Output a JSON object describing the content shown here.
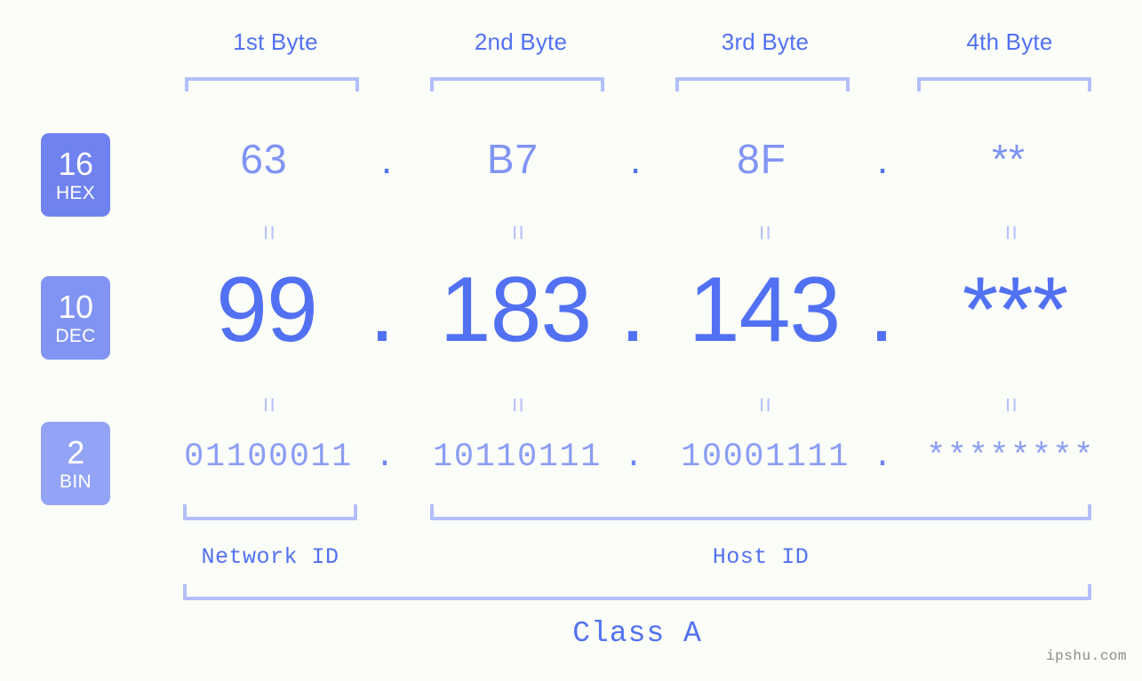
{
  "page": {
    "background": "#fbfdf8",
    "accent": "#5271f2",
    "accent_light": "#8094f3",
    "bracket_color": "#b3bffa"
  },
  "byte_headers": [
    {
      "label": "1st Byte"
    },
    {
      "label": "2nd Byte"
    },
    {
      "label": "3rd Byte"
    },
    {
      "label": "4th Byte"
    }
  ],
  "bases": [
    {
      "number": "16",
      "abbr": "HEX",
      "color": "#6f82ef"
    },
    {
      "number": "10",
      "abbr": "DEC",
      "color": "#8194f3"
    },
    {
      "number": "2",
      "abbr": "BIN",
      "color": "#93a4f6"
    }
  ],
  "rows": {
    "hex": {
      "values": [
        "63",
        "B7",
        "8F",
        "**"
      ],
      "separator": "."
    },
    "dec": {
      "values": [
        "99",
        "183",
        "143",
        "***"
      ],
      "separator": "."
    },
    "bin": {
      "values": [
        "01100011",
        "10110111",
        "10001111",
        "********"
      ],
      "separator": "."
    }
  },
  "equals_symbol": "=",
  "segments": {
    "network_id": "Network ID",
    "host_id": "Host ID",
    "class": "Class A"
  },
  "watermark": "ipshu.com"
}
